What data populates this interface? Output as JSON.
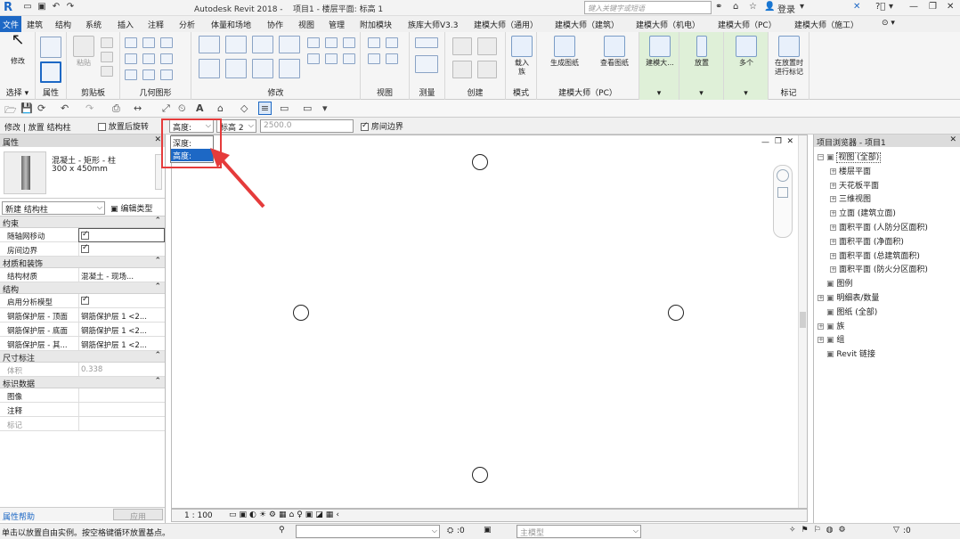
{
  "titlebar": {
    "app_title": "Autodesk Revit 2018 -",
    "project_title": "项目1 - 楼层平面: 标高 1",
    "search_placeholder": "键入关键字或短语",
    "login": "登录"
  },
  "tabs": [
    "文件",
    "建筑",
    "结构",
    "系统",
    "插入",
    "注释",
    "分析",
    "体量和场地",
    "协作",
    "视图",
    "管理",
    "附加模块",
    "族库大师V3.3",
    "建模大师（通用）",
    "建模大师（建筑）",
    "建模大师（机电）",
    "建模大师（PC）",
    "建模大师（施工）"
  ],
  "ribbon": {
    "modify": "修改",
    "paste": "粘贴",
    "load_family": "载入\n族",
    "generate_drawing": "生成图纸",
    "view_drawing": "查看图纸",
    "build_master": "建模大...",
    "place": "放置",
    "multiple": "多个",
    "tag_on_place": "在放置时\n进行标记",
    "groups": [
      "选择 ▾",
      "属性",
      "剪贴板",
      "几何图形",
      "修改",
      "视图",
      "测量",
      "创建",
      "模式",
      "建模大师（PC）",
      "标记"
    ]
  },
  "optionsbar": {
    "context": "修改 | 放置 结构柱",
    "rotate_after_place": "放置后旋转",
    "depth_combo": "高度:",
    "level_combo": "标高 2",
    "height_value": "2500.0",
    "room_bounding": "房间边界"
  },
  "dropdown": {
    "options": [
      "深度:",
      "高度:"
    ]
  },
  "properties": {
    "title": "属性",
    "type_name": "混凝土 - 矩形 - 柱",
    "type_size": "300 x 450mm",
    "instance_selector": "新建 结构柱",
    "edit_type": "编辑类型",
    "sections": [
      {
        "name": "约束",
        "rows": [
          {
            "k": "随轴网移动",
            "v": "check_on"
          },
          {
            "k": "房间边界",
            "v": "check_on"
          }
        ]
      },
      {
        "name": "材质和装饰",
        "rows": [
          {
            "k": "结构材质",
            "v": "混凝土 - 现场..."
          }
        ]
      },
      {
        "name": "结构",
        "rows": [
          {
            "k": "启用分析模型",
            "v": "check_on"
          },
          {
            "k": "钢筋保护层 - 顶面",
            "v": "钢筋保护层 1 <2..."
          },
          {
            "k": "钢筋保护层 - 底面",
            "v": "钢筋保护层 1 <2..."
          },
          {
            "k": "钢筋保护层 - 其...",
            "v": "钢筋保护层 1 <2..."
          }
        ]
      },
      {
        "name": "尺寸标注",
        "rows": [
          {
            "k": "体积",
            "v": "0.338",
            "dim": true
          }
        ]
      },
      {
        "name": "标识数据",
        "rows": [
          {
            "k": "图像",
            "v": ""
          },
          {
            "k": "注释",
            "v": ""
          },
          {
            "k": "标记",
            "v": "",
            "dim": true
          }
        ]
      }
    ],
    "help_link": "属性帮助",
    "apply": "应用"
  },
  "viewbar": {
    "scale": "1 : 100"
  },
  "browser": {
    "title": "项目浏览器 - 项目1",
    "nodes": [
      {
        "label": "视图 (全部)",
        "level": 0,
        "pm": "-",
        "sel": true
      },
      {
        "label": "楼层平面",
        "level": 1,
        "pm": "+"
      },
      {
        "label": "天花板平面",
        "level": 1,
        "pm": "+"
      },
      {
        "label": "三维视图",
        "level": 1,
        "pm": "+"
      },
      {
        "label": "立面 (建筑立面)",
        "level": 1,
        "pm": "+"
      },
      {
        "label": "面积平面 (人防分区面积)",
        "level": 1,
        "pm": "+"
      },
      {
        "label": "面积平面 (净面积)",
        "level": 1,
        "pm": "+"
      },
      {
        "label": "面积平面 (总建筑面积)",
        "level": 1,
        "pm": "+"
      },
      {
        "label": "面积平面 (防火分区面积)",
        "level": 1,
        "pm": "+"
      },
      {
        "label": "图例",
        "level": 0,
        "pm": ""
      },
      {
        "label": "明细表/数量",
        "level": 0,
        "pm": "+"
      },
      {
        "label": "图纸 (全部)",
        "level": 0,
        "pm": ""
      },
      {
        "label": "族",
        "level": 0,
        "pm": "+"
      },
      {
        "label": "组",
        "level": 0,
        "pm": "+"
      },
      {
        "label": "Revit 链接",
        "level": 0,
        "pm": ""
      }
    ]
  },
  "statusbar": {
    "message": "单击以放置自由实例。按空格键循环放置基点。",
    "count1": ":0",
    "model": "主模型",
    "count2": ":0"
  },
  "colors": {
    "accent": "#1d68c5",
    "highlight_box": "#e53b3b"
  }
}
